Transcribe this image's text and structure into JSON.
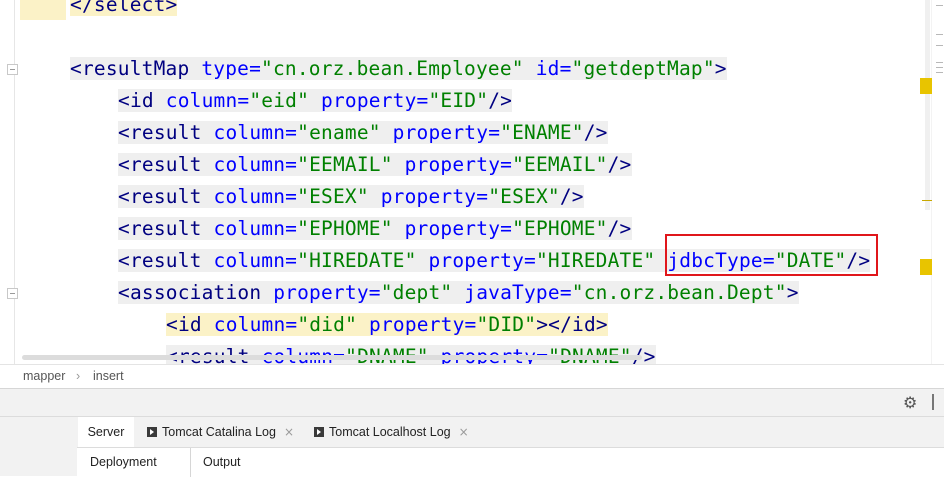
{
  "editor": {
    "lines": [
      {
        "parts": [
          {
            "c": "t",
            "s": "</select>"
          }
        ]
      },
      {
        "parts": []
      },
      {
        "parts": [
          {
            "c": "t",
            "s": "<resultMap "
          },
          {
            "c": "a",
            "s": "type="
          },
          {
            "c": "v",
            "s": "\"cn.orz.bean.Employee\""
          },
          {
            "c": "p",
            "s": " "
          },
          {
            "c": "a",
            "s": "id="
          },
          {
            "c": "v",
            "s": "\"getdeptMap\""
          },
          {
            "c": "t",
            "s": ">"
          }
        ]
      },
      {
        "parts": [
          {
            "c": "t",
            "s": "<id "
          },
          {
            "c": "a",
            "s": "column="
          },
          {
            "c": "v",
            "s": "\"eid\""
          },
          {
            "c": "p",
            "s": " "
          },
          {
            "c": "a",
            "s": "property="
          },
          {
            "c": "v",
            "s": "\"EID\""
          },
          {
            "c": "t",
            "s": "/>"
          }
        ]
      },
      {
        "parts": [
          {
            "c": "t",
            "s": "<result "
          },
          {
            "c": "a",
            "s": "column="
          },
          {
            "c": "v",
            "s": "\"ename\""
          },
          {
            "c": "p",
            "s": " "
          },
          {
            "c": "a",
            "s": "property="
          },
          {
            "c": "v",
            "s": "\"ENAME\""
          },
          {
            "c": "t",
            "s": "/>"
          }
        ]
      },
      {
        "parts": [
          {
            "c": "t",
            "s": "<result "
          },
          {
            "c": "a",
            "s": "column="
          },
          {
            "c": "v",
            "s": "\"EEMAIL\""
          },
          {
            "c": "p",
            "s": " "
          },
          {
            "c": "a",
            "s": "property="
          },
          {
            "c": "v",
            "s": "\"EEMAIL\""
          },
          {
            "c": "t",
            "s": "/>"
          }
        ]
      },
      {
        "parts": [
          {
            "c": "t",
            "s": "<result "
          },
          {
            "c": "a",
            "s": "column="
          },
          {
            "c": "v",
            "s": "\"ESEX\""
          },
          {
            "c": "p",
            "s": " "
          },
          {
            "c": "a",
            "s": "property="
          },
          {
            "c": "v",
            "s": "\"ESEX\""
          },
          {
            "c": "t",
            "s": "/>"
          }
        ]
      },
      {
        "parts": [
          {
            "c": "t",
            "s": "<result "
          },
          {
            "c": "a",
            "s": "column="
          },
          {
            "c": "v",
            "s": "\"EPHOME\""
          },
          {
            "c": "p",
            "s": " "
          },
          {
            "c": "a",
            "s": "property="
          },
          {
            "c": "v",
            "s": "\"EPHOME\""
          },
          {
            "c": "t",
            "s": "/>"
          }
        ]
      },
      {
        "parts": [
          {
            "c": "t",
            "s": "<result "
          },
          {
            "c": "a",
            "s": "column="
          },
          {
            "c": "v",
            "s": "\"HIREDATE\""
          },
          {
            "c": "p",
            "s": " "
          },
          {
            "c": "a",
            "s": "property="
          },
          {
            "c": "v",
            "s": "\"HIREDATE\""
          },
          {
            "c": "p",
            "s": " "
          },
          {
            "c": "a",
            "s": "jdbcType="
          },
          {
            "c": "v",
            "s": "\"DATE\""
          },
          {
            "c": "t",
            "s": "/>"
          }
        ]
      },
      {
        "parts": [
          {
            "c": "t",
            "s": "<association "
          },
          {
            "c": "a",
            "s": "property="
          },
          {
            "c": "v",
            "s": "\"dept\""
          },
          {
            "c": "p",
            "s": " "
          },
          {
            "c": "a",
            "s": "javaType="
          },
          {
            "c": "v",
            "s": "\"cn.orz.bean.Dept\""
          },
          {
            "c": "t",
            "s": ">"
          }
        ]
      },
      {
        "parts": [
          {
            "c": "t",
            "s": "<id "
          },
          {
            "c": "a",
            "s": "column="
          },
          {
            "c": "v",
            "s": "\"did\""
          },
          {
            "c": "p",
            "s": " "
          },
          {
            "c": "a",
            "s": "property="
          },
          {
            "c": "v",
            "s": "\"DID\""
          },
          {
            "c": "t",
            "s": "></id>"
          }
        ]
      },
      {
        "parts": [
          {
            "c": "t",
            "s": "<result "
          },
          {
            "c": "a",
            "s": "column="
          },
          {
            "c": "v",
            "s": "\"DNAME\""
          },
          {
            "c": "p",
            "s": " "
          },
          {
            "c": "a",
            "s": "property="
          },
          {
            "c": "v",
            "s": "\"DNAME\""
          },
          {
            "c": "t",
            "s": "/>"
          }
        ]
      }
    ]
  },
  "breadcrumb": {
    "items": [
      "mapper",
      "insert"
    ]
  },
  "colors": {
    "tag": "#000080",
    "attr": "#0000ff",
    "value": "#008000",
    "highlight_box": "#e0161b",
    "marker": "#e8c400"
  },
  "toolwindow": {
    "settings_icon": "gear-icon",
    "tabs": [
      {
        "label": "Server",
        "icon": "",
        "closable": false
      },
      {
        "label": "Tomcat Catalina Log",
        "icon": "console-icon",
        "closable": true
      },
      {
        "label": "Tomcat Localhost Log",
        "icon": "console-icon",
        "closable": true
      }
    ],
    "close_glyph": "×",
    "subtabs": [
      "Deployment",
      "Output"
    ]
  }
}
